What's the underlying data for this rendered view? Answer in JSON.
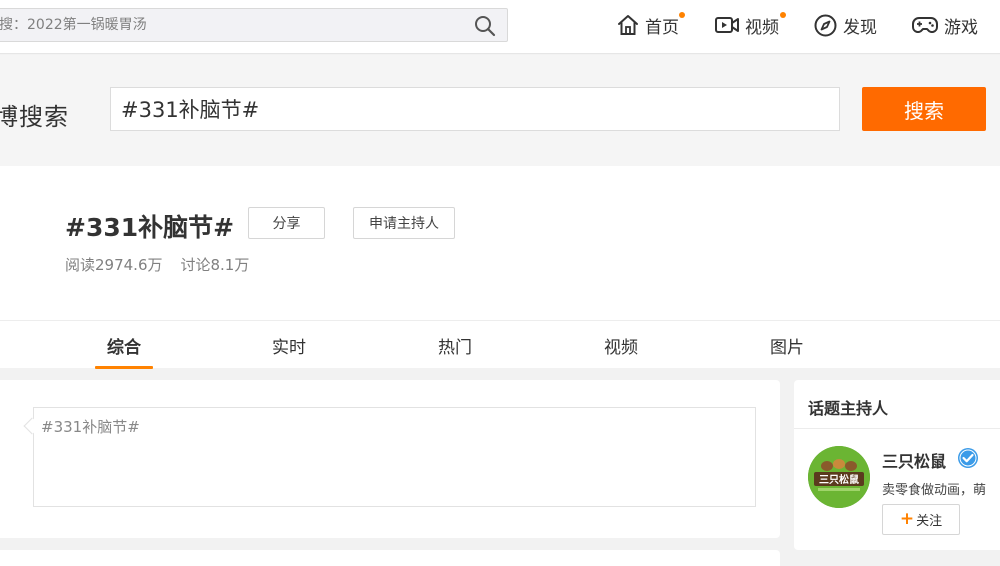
{
  "topbar": {
    "search_placeholder": "搜：2022第一锅暖胃汤",
    "nav": [
      {
        "label": "首页",
        "icon": "home-icon",
        "dot": true
      },
      {
        "label": "视频",
        "icon": "video-icon",
        "dot": true
      },
      {
        "label": "发现",
        "icon": "compass-icon",
        "dot": false
      },
      {
        "label": "游戏",
        "icon": "gamepad-icon",
        "dot": false
      }
    ]
  },
  "search": {
    "title": "博搜索",
    "query": "#331补脑节#",
    "button": "搜索"
  },
  "topic": {
    "title": "#331补脑节#",
    "share_button": "分享",
    "host_button": "申请主持人",
    "reads": "阅读2974.6万",
    "discussions": "讨论8.1万"
  },
  "tabs": [
    "综合",
    "实时",
    "热门",
    "视频",
    "图片"
  ],
  "compose": {
    "text": "#331补脑节#"
  },
  "sidebar": {
    "title": "话题主持人",
    "host": {
      "name": "三只松鼠",
      "avatar_text": "三只松鼠",
      "description": "卖零食做动画，萌",
      "follow_label": "关注",
      "follow_plus": "+"
    }
  },
  "colors": {
    "accent": "#ff8200",
    "search_button": "#ff6a00",
    "verified": "#3b9be8"
  }
}
